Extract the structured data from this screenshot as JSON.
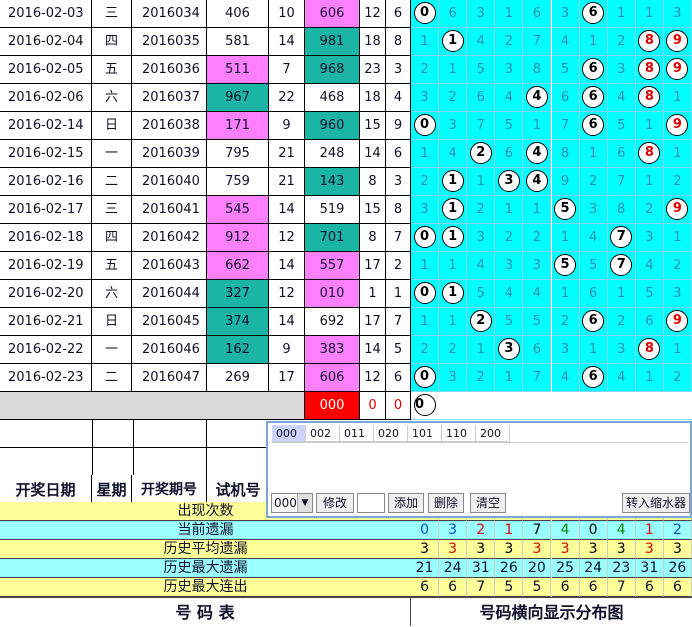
{
  "rows": [
    {
      "date": "2016-02-03",
      "wd": "三",
      "issue": "2016034",
      "trial": "406",
      "s1": "10",
      "num": "606",
      "a": "12",
      "b": "6",
      "d": [
        "0",
        "6",
        "3",
        "1",
        "6",
        "3",
        "6",
        "1",
        "1",
        "3"
      ],
      "balls": [
        0,
        6
      ],
      "trialc": "",
      "numc": "pink"
    },
    {
      "date": "2016-02-04",
      "wd": "四",
      "issue": "2016035",
      "trial": "581",
      "s1": "14",
      "num": "981",
      "a": "18",
      "b": "8",
      "d": [
        "1",
        "1",
        "4",
        "2",
        "7",
        "4",
        "1",
        "2",
        "8",
        "9"
      ],
      "balls": [
        1,
        8,
        9
      ],
      "trialc": "",
      "numc": "teal"
    },
    {
      "date": "2016-02-05",
      "wd": "五",
      "issue": "2016036",
      "trial": "511",
      "s1": "7",
      "num": "968",
      "a": "23",
      "b": "3",
      "d": [
        "2",
        "1",
        "5",
        "3",
        "8",
        "5",
        "6",
        "3",
        "8",
        "9"
      ],
      "balls": [
        6,
        8,
        9
      ],
      "trialc": "pink",
      "numc": "teal"
    },
    {
      "date": "2016-02-06",
      "wd": "六",
      "issue": "2016037",
      "trial": "967",
      "s1": "22",
      "num": "468",
      "a": "18",
      "b": "4",
      "d": [
        "3",
        "2",
        "6",
        "4",
        "4",
        "6",
        "6",
        "4",
        "8",
        "1"
      ],
      "balls": [
        4,
        6,
        8
      ],
      "trialc": "teal",
      "numc": ""
    },
    {
      "date": "2016-02-14",
      "wd": "日",
      "issue": "2016038",
      "trial": "171",
      "s1": "9",
      "num": "960",
      "a": "15",
      "b": "9",
      "d": [
        "0",
        "3",
        "7",
        "5",
        "1",
        "7",
        "6",
        "5",
        "1",
        "9"
      ],
      "balls": [
        0,
        6,
        9
      ],
      "trialc": "pink",
      "numc": "teal"
    },
    {
      "date": "2016-02-15",
      "wd": "一",
      "issue": "2016039",
      "trial": "795",
      "s1": "21",
      "num": "248",
      "a": "14",
      "b": "6",
      "d": [
        "1",
        "4",
        "2",
        "6",
        "4",
        "8",
        "1",
        "6",
        "8",
        "1"
      ],
      "balls": [
        2,
        4,
        8
      ],
      "trialc": "",
      "numc": ""
    },
    {
      "date": "2016-02-16",
      "wd": "二",
      "issue": "2016040",
      "trial": "759",
      "s1": "21",
      "num": "143",
      "a": "8",
      "b": "3",
      "d": [
        "2",
        "1",
        "1",
        "3",
        "4",
        "9",
        "2",
        "7",
        "1",
        "2"
      ],
      "balls": [
        1,
        3,
        4
      ],
      "trialc": "",
      "numc": "teal"
    },
    {
      "date": "2016-02-17",
      "wd": "三",
      "issue": "2016041",
      "trial": "545",
      "s1": "14",
      "num": "519",
      "a": "15",
      "b": "8",
      "d": [
        "3",
        "1",
        "2",
        "1",
        "1",
        "5",
        "3",
        "8",
        "2",
        "9"
      ],
      "balls": [
        1,
        5,
        9
      ],
      "trialc": "pink",
      "numc": ""
    },
    {
      "date": "2016-02-18",
      "wd": "四",
      "issue": "2016042",
      "trial": "912",
      "s1": "12",
      "num": "701",
      "a": "8",
      "b": "7",
      "d": [
        "0",
        "1",
        "3",
        "2",
        "2",
        "1",
        "4",
        "7",
        "3",
        "1"
      ],
      "balls": [
        0,
        1,
        7
      ],
      "trialc": "pink",
      "numc": "teal"
    },
    {
      "date": "2016-02-19",
      "wd": "五",
      "issue": "2016043",
      "trial": "662",
      "s1": "14",
      "num": "557",
      "a": "17",
      "b": "2",
      "d": [
        "1",
        "1",
        "4",
        "3",
        "3",
        "5",
        "5",
        "7",
        "4",
        "2"
      ],
      "balls": [
        5,
        7
      ],
      "trialc": "pink",
      "numc": "pink"
    },
    {
      "date": "2016-02-20",
      "wd": "六",
      "issue": "2016044",
      "trial": "327",
      "s1": "12",
      "num": "010",
      "a": "1",
      "b": "1",
      "d": [
        "0",
        "1",
        "5",
        "4",
        "4",
        "1",
        "6",
        "1",
        "5",
        "3"
      ],
      "balls": [
        0,
        1
      ],
      "trialc": "teal",
      "numc": "pink"
    },
    {
      "date": "2016-02-21",
      "wd": "日",
      "issue": "2016045",
      "trial": "374",
      "s1": "14",
      "num": "692",
      "a": "17",
      "b": "7",
      "d": [
        "1",
        "1",
        "2",
        "5",
        "5",
        "2",
        "6",
        "2",
        "6",
        "9"
      ],
      "balls": [
        2,
        6,
        9
      ],
      "trialc": "teal",
      "numc": ""
    },
    {
      "date": "2016-02-22",
      "wd": "一",
      "issue": "2016046",
      "trial": "162",
      "s1": "9",
      "num": "383",
      "a": "14",
      "b": "5",
      "d": [
        "2",
        "2",
        "1",
        "3",
        "6",
        "3",
        "1",
        "3",
        "8",
        "1"
      ],
      "balls": [
        3,
        8
      ],
      "trialc": "teal",
      "numc": "pink"
    },
    {
      "date": "2016-02-23",
      "wd": "二",
      "issue": "2016047",
      "trial": "269",
      "s1": "17",
      "num": "606",
      "a": "12",
      "b": "6",
      "d": [
        "0",
        "3",
        "2",
        "1",
        "7",
        "4",
        "6",
        "4",
        "1",
        "2"
      ],
      "balls": [
        0,
        6
      ],
      "trialc": "",
      "numc": "pink"
    }
  ],
  "pending": {
    "num": "000",
    "a": "0",
    "b": "0",
    "ball": "0"
  },
  "header": {
    "date": "开奖日期",
    "wd": "星期",
    "issue": "开奖期号",
    "trial": "试机号"
  },
  "dialog": {
    "tabs": [
      "000",
      "002",
      "011",
      "020",
      "101",
      "110",
      "200"
    ],
    "select_value": "000",
    "modify_label": "修改",
    "add_label": "添加",
    "delete_label": "删除",
    "clear_label": "清空",
    "shrink_label": "转入缩水器"
  },
  "stats": [
    {
      "label": "出现次数",
      "bg": "yellow",
      "values": [
        "",
        "",
        "",
        "",
        "",
        "",
        "",
        "",
        "",
        ""
      ],
      "colors": []
    },
    {
      "label": "当前遗漏",
      "bg": "cyan",
      "values": [
        "0",
        "3",
        "2",
        "1",
        "7",
        "4",
        "0",
        "4",
        "1",
        "2"
      ],
      "colors": [
        "#0050d0",
        "#0050d0",
        "#d00",
        "#d00",
        "#000",
        "#0a8a0a",
        "#000",
        "#0a8a0a",
        "#d00",
        "#0050d0"
      ]
    },
    {
      "label": "历史平均遗漏",
      "bg": "yellow",
      "values": [
        "3",
        "3",
        "3",
        "3",
        "3",
        "3",
        "3",
        "3",
        "3",
        "3"
      ],
      "colors": [
        "#000",
        "#d00",
        "#000",
        "#000",
        "#d00",
        "#d00",
        "#000",
        "#000",
        "#d00",
        "#000"
      ]
    },
    {
      "label": "历史最大遗漏",
      "bg": "cyan",
      "values": [
        "21",
        "24",
        "31",
        "26",
        "20",
        "25",
        "24",
        "23",
        "31",
        "26"
      ],
      "colors": []
    },
    {
      "label": "历史最大连出",
      "bg": "yellow",
      "values": [
        "6",
        "6",
        "7",
        "5",
        "5",
        "6",
        "6",
        "7",
        "6",
        "6"
      ],
      "colors": []
    }
  ],
  "footer": {
    "left": "号 码 表",
    "right": "号码横向显示分布图"
  }
}
